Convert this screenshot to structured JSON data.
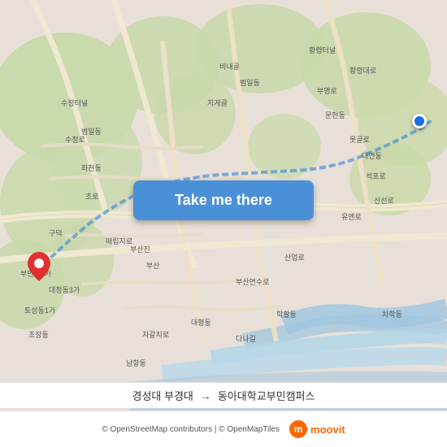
{
  "map": {
    "background_color": "#e8e0d8",
    "water_color": "#b8d4e8",
    "green_color": "#c8d8b0"
  },
  "button": {
    "label": "Take me there"
  },
  "footer": {
    "copyright": "© OpenStreetMap contributors | © OpenMapTiles",
    "route_from": "경성대 부경대",
    "route_to": "동아대학교부민캠퍼스",
    "arrow": "→"
  },
  "markers": {
    "origin_color": "#e03030",
    "dest_color": "#1a6ee8"
  },
  "branding": {
    "logo_letter": "m",
    "logo_text": "moovit"
  }
}
